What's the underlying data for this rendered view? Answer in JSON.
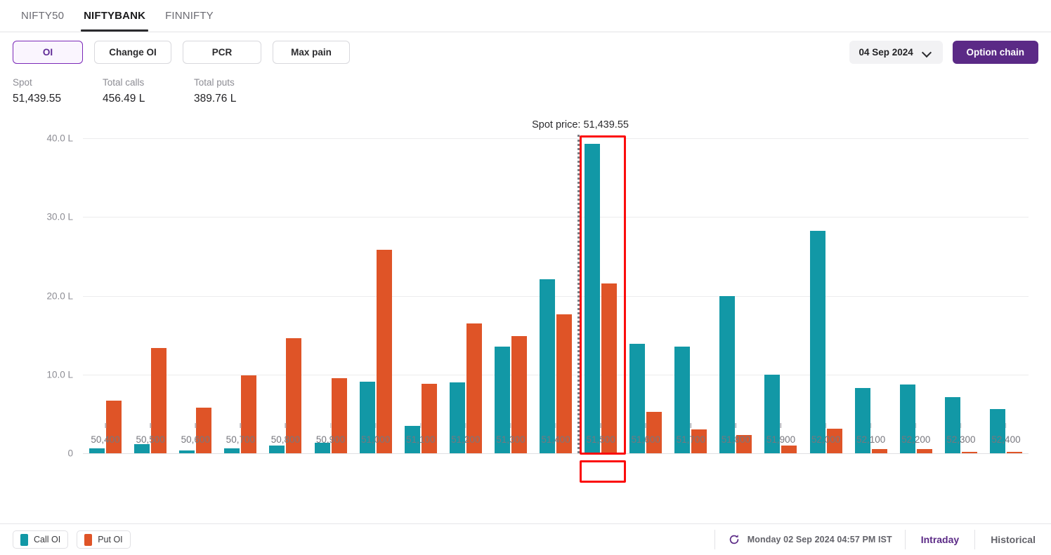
{
  "tabs": [
    {
      "label": "NIFTY50",
      "active": false
    },
    {
      "label": "NIFTYBANK",
      "active": true
    },
    {
      "label": "FINNIFTY",
      "active": false
    }
  ],
  "toolbar": {
    "oi_label": "OI",
    "change_oi_label": "Change OI",
    "pcr_label": "PCR",
    "max_pain_label": "Max pain",
    "selected": "OI"
  },
  "controls": {
    "date_value": "04 Sep 2024",
    "date_chevron_icon": "chevron-down-icon",
    "option_chain_label": "Option chain"
  },
  "stats": [
    {
      "label": "Spot",
      "value": "51,439.55"
    },
    {
      "label": "Total calls",
      "value": "456.49 L"
    },
    {
      "label": "Total puts",
      "value": "389.76 L"
    }
  ],
  "annotation": {
    "spot_price_text": "Spot price: 51,439.55",
    "highlighted_strike": "51,500",
    "highlight_color": "#fb0b0b"
  },
  "footer": {
    "legend": [
      {
        "label": "Call OI",
        "color": "#1298a6"
      },
      {
        "label": "Put OI",
        "color": "#df5427"
      }
    ],
    "refresh_icon": "refresh-icon",
    "timestamp": "Monday 02 Sep 2024 04:57 PM IST",
    "intraday_label": "Intraday",
    "historical_label": "Historical"
  },
  "chart_data": {
    "type": "bar",
    "title": "",
    "xlabel": "",
    "ylabel": "",
    "ylim": [
      0,
      44.5
    ],
    "yticks": [
      0,
      10,
      20,
      30,
      40
    ],
    "ytick_labels": [
      "0",
      "10.0 L",
      "20.0 L",
      "30.0 L",
      "40.0 L"
    ],
    "grid": true,
    "legend_position": "bottom-left",
    "categories": [
      "50,400",
      "50,500",
      "50,600",
      "50,700",
      "50,800",
      "50,900",
      "51,000",
      "51,100",
      "51,200",
      "51,300",
      "51,400",
      "51,500",
      "51,600",
      "51,700",
      "51,800",
      "51,900",
      "52,000",
      "52,100",
      "52,200",
      "52,300",
      "52,400"
    ],
    "series": [
      {
        "name": "Call OI",
        "color": "#1298a6",
        "values": [
          0.6,
          1.2,
          0.4,
          0.6,
          1.0,
          1.3,
          9.1,
          3.5,
          9.0,
          13.5,
          22.1,
          39.3,
          13.9,
          13.5,
          20.0,
          10.0,
          28.2,
          8.3,
          8.7,
          7.1,
          5.6
        ]
      },
      {
        "name": "Put OI",
        "color": "#df5427",
        "values": [
          6.7,
          13.4,
          5.8,
          9.9,
          14.6,
          9.5,
          25.8,
          8.8,
          16.5,
          14.9,
          17.6,
          21.6,
          5.3,
          3.0,
          2.3,
          1.0,
          3.1,
          0.5,
          0.5,
          0.15,
          0.2
        ]
      }
    ],
    "annotations": [
      {
        "type": "vline",
        "label": "Spot price: 51,439.55",
        "value": 51439.55
      },
      {
        "type": "highlight-box",
        "category": "51,500"
      }
    ]
  }
}
